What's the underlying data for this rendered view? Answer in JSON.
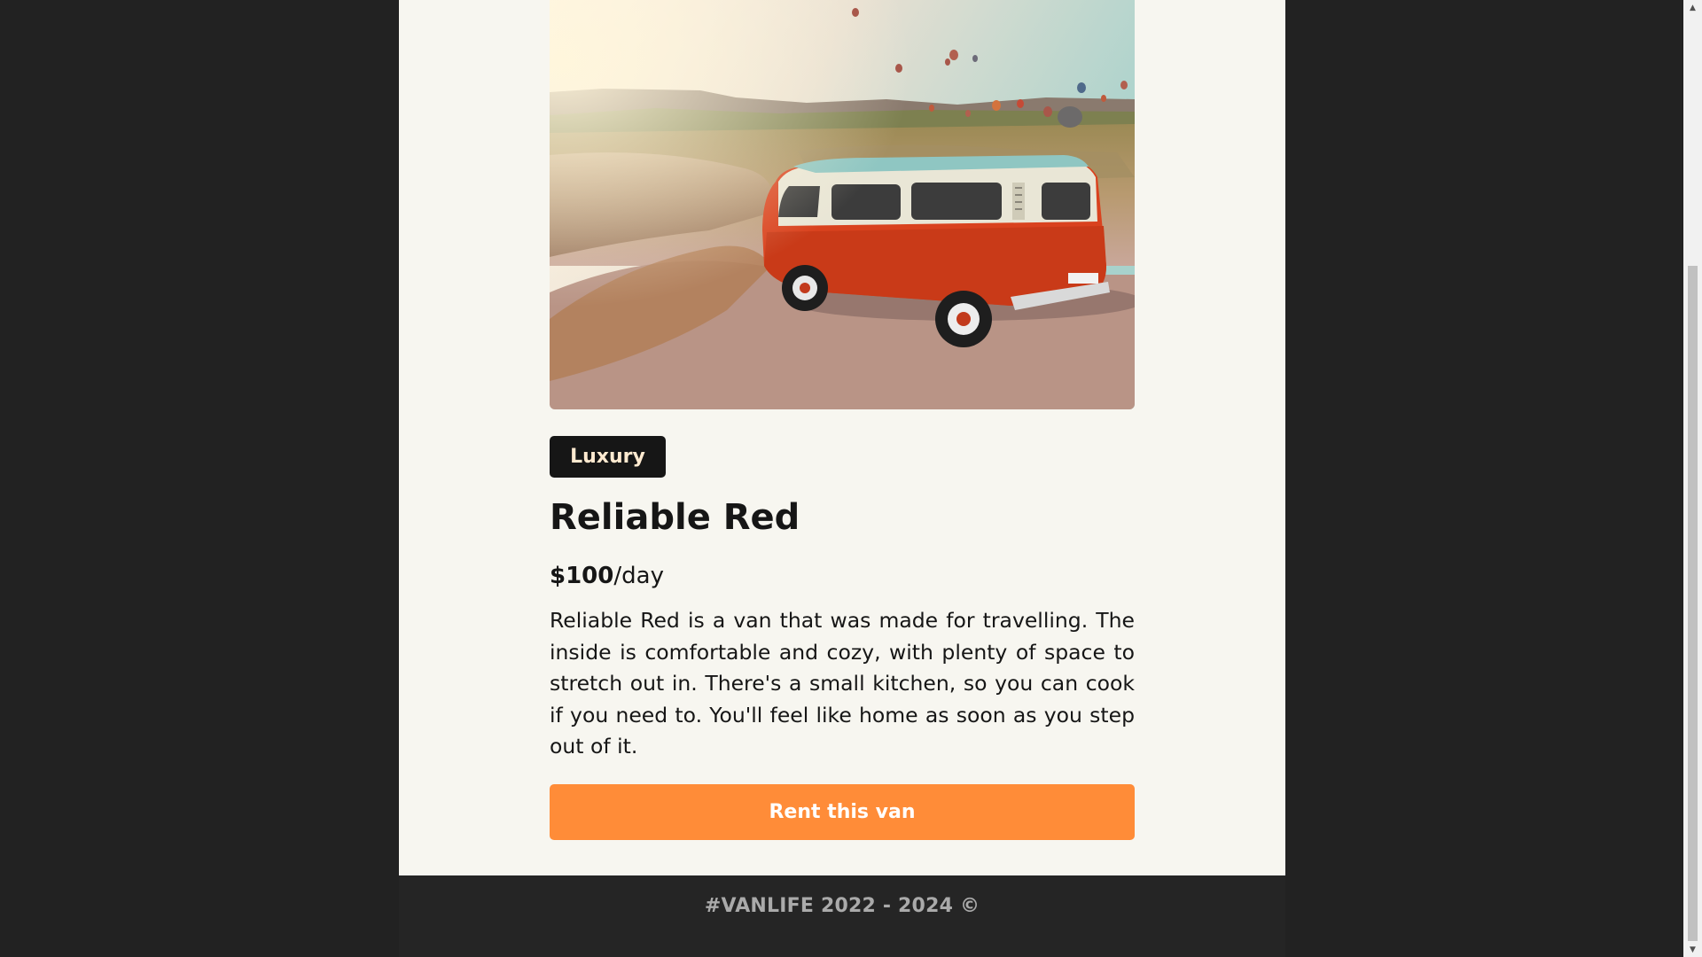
{
  "van": {
    "type": "Luxury",
    "name": "Reliable Red",
    "price": "$100",
    "price_unit": "/day",
    "description": "Reliable Red is a van that was made for travelling. The inside is comfortable and cozy, with plenty of space to stretch out in. There's a small kitchen, so you can cook if you need to. You'll feel like home as soon as you step out of it.",
    "rent_label": "Rent this van"
  },
  "footer": {
    "text": "#VANLIFE 2022 - 2024 ©"
  },
  "colors": {
    "page_background": "#222222",
    "content_background": "#f7f6f0",
    "badge_background": "#161616",
    "badge_text": "#ffead0",
    "accent": "#ff8c38",
    "footer_background": "#252525"
  },
  "icons": {
    "scroll_up": "scroll-up-arrow-icon",
    "scroll_down": "scroll-down-arrow-icon"
  }
}
